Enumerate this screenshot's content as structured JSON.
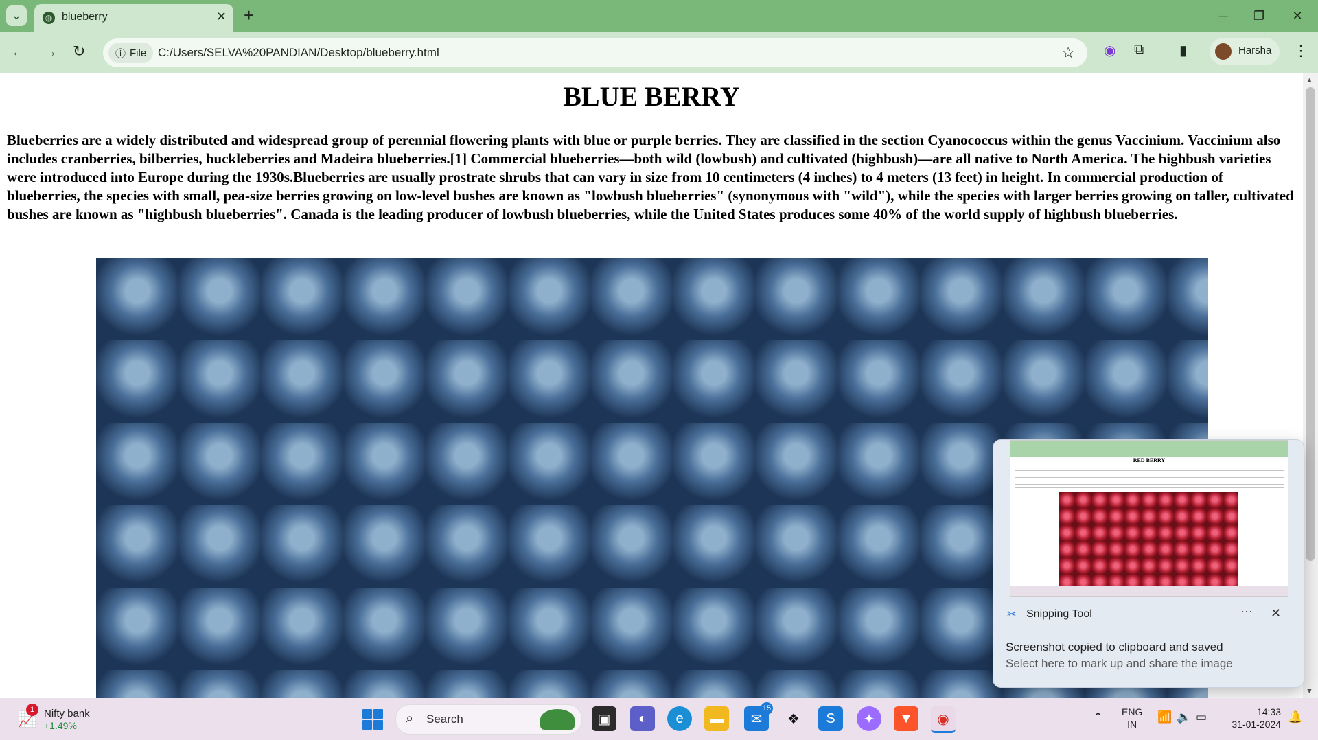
{
  "browser": {
    "tab_title": "blueberry",
    "file_chip": "File",
    "url": "C:/Users/SELVA%20PANDIAN/Desktop/blueberry.html",
    "profile_name": "Harsha"
  },
  "page": {
    "title": "BLUE BERRY",
    "paragraph": "Blueberries are a widely distributed and widespread group of perennial flowering plants with blue or purple berries. They are classified in the section Cyanococcus within the genus Vaccinium. Vaccinium also includes cranberries, bilberries, huckleberries and Madeira blueberries.[1] Commercial blueberries—both wild (lowbush) and cultivated (highbush)—are all native to North America. The highbush varieties were introduced into Europe during the 1930s.Blueberries are usually prostrate shrubs that can vary in size from 10 centimeters (4 inches) to 4 meters (13 feet) in height. In commercial production of blueberries, the species with small, pea-size berries growing on low-level bushes are known as \"lowbush blueberries\" (synonymous with \"wild\"), while the species with larger berries growing on taller, cultivated bushes are known as \"highbush blueberries\". Canada is the leading producer of lowbush blueberries, while the United States produces some 40% of the world supply of highbush blueberries."
  },
  "toast": {
    "preview_title": "RED BERRY",
    "app_name": "Snipping Tool",
    "heading": "Screenshot copied to clipboard and saved",
    "subtext": "Select here to mark up and share the image"
  },
  "taskbar": {
    "widget_badge": "1",
    "widget_title": "Nifty bank",
    "widget_value": "+1.49%",
    "search_placeholder": "Search",
    "mail_badge": "15",
    "lang_line1": "ENG",
    "lang_line2": "IN",
    "time": "14:33",
    "date": "31-01-2024"
  },
  "colors": {
    "tab_strip": "#7ab87a",
    "toolbar": "#cfe7cf",
    "taskbar": "#ece0ec",
    "accent": "#1c7bd8"
  },
  "icons": [
    "tab-search-icon",
    "globe-icon",
    "close-icon",
    "plus-icon",
    "minimize-icon",
    "restore-icon",
    "back-icon",
    "forward-icon",
    "reload-icon",
    "info-icon",
    "star-icon",
    "extension-icon",
    "puzzle-icon",
    "side-panel-icon",
    "more-icon",
    "windows-start-icon",
    "search-icon",
    "wifi-icon",
    "volume-icon",
    "battery-icon",
    "bell-icon"
  ]
}
